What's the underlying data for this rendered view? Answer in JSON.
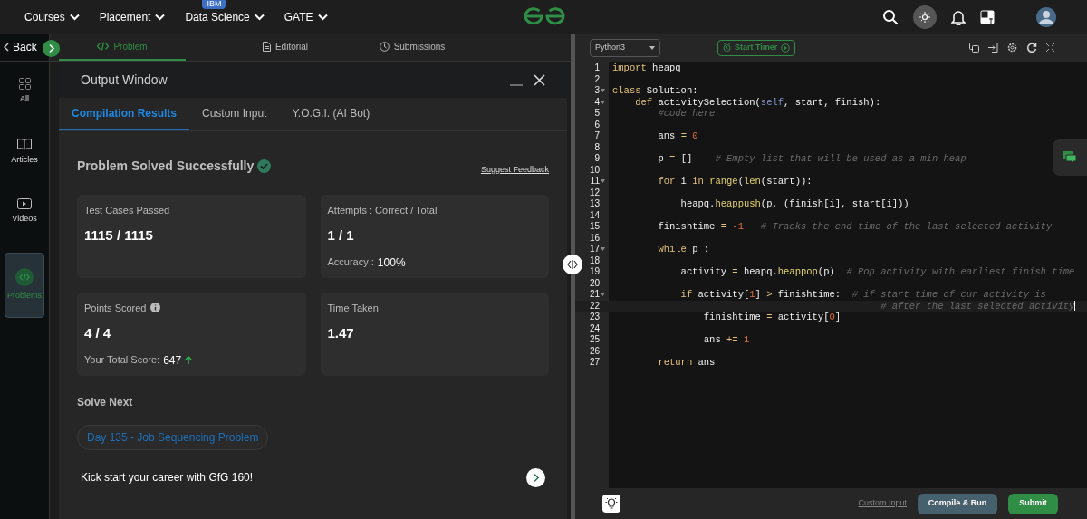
{
  "nav": {
    "menus": [
      {
        "label": "Courses"
      },
      {
        "label": "Placement"
      },
      {
        "label": "Data Science",
        "badge": "IBM"
      },
      {
        "label": "GATE"
      }
    ]
  },
  "sidebar": {
    "back": "Back",
    "items": [
      {
        "label": "All",
        "selected": false
      },
      {
        "label": "Articles",
        "selected": false
      },
      {
        "label": "Videos",
        "selected": false
      },
      {
        "label": "Problems",
        "selected": true
      }
    ]
  },
  "problem_tabs": [
    {
      "label": "Problem",
      "selected": true
    },
    {
      "label": "Editorial",
      "selected": false
    },
    {
      "label": "Submissions",
      "selected": false
    }
  ],
  "output_window": {
    "title": "Output Window",
    "tabs": [
      {
        "label": "Compilation Results",
        "selected": true
      },
      {
        "label": "Custom Input",
        "selected": false
      },
      {
        "label": "Y.O.G.I. (AI Bot)",
        "selected": false
      }
    ],
    "status": "Problem Solved Successfully",
    "feedback_link": "Suggest Feedback",
    "cards": [
      {
        "label": "Test Cases Passed",
        "value": "1115 / 1115",
        "info": false
      },
      {
        "label": "Attempts : Correct / Total",
        "value": "1 / 1",
        "note_label": "Accuracy :",
        "note_value": "100%",
        "info": false
      },
      {
        "label": "Points Scored",
        "value": "4 / 4",
        "note_label": "Your Total Score:",
        "note_value": "647",
        "info": true
      },
      {
        "label": "Time Taken",
        "value": "1.47",
        "info": false
      }
    ],
    "solve_next_heading": "Solve Next",
    "next_problem": "Day 135 - Job Sequencing Problem",
    "promo": "Kick start your career with GfG 160!"
  },
  "editor": {
    "language": "Python3",
    "timer_button": "Start Timer",
    "lines": [
      {
        "n": "1",
        "tokens": [
          {
            "kind": "kw",
            "text": "import"
          },
          {
            "kind": "t",
            "text": " heapq"
          }
        ]
      },
      {
        "n": "2"
      },
      {
        "n": "3",
        "foldable": true,
        "tokens": [
          {
            "kind": "kw",
            "text": "class"
          },
          {
            "kind": "t",
            "text": " Solution:"
          }
        ]
      },
      {
        "n": "4",
        "foldable": true,
        "tokens": [
          {
            "kind": "kw",
            "text": "    def"
          },
          {
            "kind": "t",
            "text": " activitySelection("
          },
          {
            "kind": "self",
            "text": "self"
          },
          {
            "kind": "t",
            "text": ", start, finish):"
          }
        ]
      },
      {
        "n": "5",
        "tokens": [
          {
            "kind": "cm",
            "text": "        #code here"
          }
        ]
      },
      {
        "n": "6"
      },
      {
        "n": "7",
        "tokens": [
          {
            "kind": "t",
            "text": "        ans "
          },
          {
            "kind": "op",
            "text": "= "
          },
          {
            "kind": "num",
            "text": "0"
          }
        ]
      },
      {
        "n": "8"
      },
      {
        "n": "9",
        "tokens": [
          {
            "kind": "t",
            "text": "        p "
          },
          {
            "kind": "op",
            "text": "="
          },
          {
            "kind": "t",
            "text": " []    "
          },
          {
            "kind": "cm",
            "text": "# Empty list that will be used as a min-heap"
          }
        ]
      },
      {
        "n": "10"
      },
      {
        "n": "11",
        "foldable": true,
        "tokens": [
          {
            "kind": "kw",
            "text": "        for"
          },
          {
            "kind": "t",
            "text": " i "
          },
          {
            "kind": "kw",
            "text": "in "
          },
          {
            "kind": "fn",
            "text": "range"
          },
          {
            "kind": "t",
            "text": "("
          },
          {
            "kind": "fn",
            "text": "len"
          },
          {
            "kind": "t",
            "text": "(start)):"
          }
        ]
      },
      {
        "n": "12"
      },
      {
        "n": "13",
        "tokens": [
          {
            "kind": "t",
            "text": "            heapq."
          },
          {
            "kind": "fn",
            "text": "heappush"
          },
          {
            "kind": "t",
            "text": "(p, (finish[i], start[i]))"
          }
        ]
      },
      {
        "n": "14"
      },
      {
        "n": "15",
        "tokens": [
          {
            "kind": "t",
            "text": "        finishtime "
          },
          {
            "kind": "op",
            "text": "= "
          },
          {
            "kind": "num",
            "text": "-1   "
          },
          {
            "kind": "cm",
            "text": "# Tracks the end time of the last selected activity"
          }
        ]
      },
      {
        "n": "16"
      },
      {
        "n": "17",
        "foldable": true,
        "tokens": [
          {
            "kind": "kw",
            "text": "        while"
          },
          {
            "kind": "t",
            "text": " p :"
          }
        ]
      },
      {
        "n": "18"
      },
      {
        "n": "19",
        "tokens": [
          {
            "kind": "t",
            "text": "            activity "
          },
          {
            "kind": "op",
            "text": "="
          },
          {
            "kind": "t",
            "text": " heapq."
          },
          {
            "kind": "fn",
            "text": "heappop"
          },
          {
            "kind": "t",
            "text": "(p)  "
          },
          {
            "kind": "cm",
            "text": "# Pop activity with earliest finish time"
          }
        ]
      },
      {
        "n": "20"
      },
      {
        "n": "21",
        "foldable": true,
        "tokens": [
          {
            "kind": "kw",
            "text": "            if"
          },
          {
            "kind": "t",
            "text": " activity["
          },
          {
            "kind": "num",
            "text": "1"
          },
          {
            "kind": "t",
            "text": "] "
          },
          {
            "kind": "op",
            "text": ">"
          },
          {
            "kind": "t",
            "text": " finishtime:  "
          },
          {
            "kind": "cm",
            "text": "# if start time of cur activity is"
          }
        ]
      },
      {
        "n": "22",
        "active": true,
        "tokens": [
          {
            "kind": "cm",
            "text": "                                               # after the last selected activity"
          }
        ]
      },
      {
        "n": "23",
        "tokens": [
          {
            "kind": "t",
            "text": "                finishtime "
          },
          {
            "kind": "op",
            "text": "="
          },
          {
            "kind": "t",
            "text": " activity["
          },
          {
            "kind": "num",
            "text": "0"
          },
          {
            "kind": "t",
            "text": "]"
          }
        ]
      },
      {
        "n": "24"
      },
      {
        "n": "25",
        "tokens": [
          {
            "kind": "t",
            "text": "                ans "
          },
          {
            "kind": "op",
            "text": "+= "
          },
          {
            "kind": "num",
            "text": "1"
          }
        ]
      },
      {
        "n": "26"
      },
      {
        "n": "27",
        "tokens": [
          {
            "kind": "kw",
            "text": "        return"
          },
          {
            "kind": "t",
            "text": " ans"
          }
        ]
      }
    ],
    "custom_input_link": "Custom Input",
    "run_button": "Compile & Run",
    "submit_button": "Submit"
  }
}
